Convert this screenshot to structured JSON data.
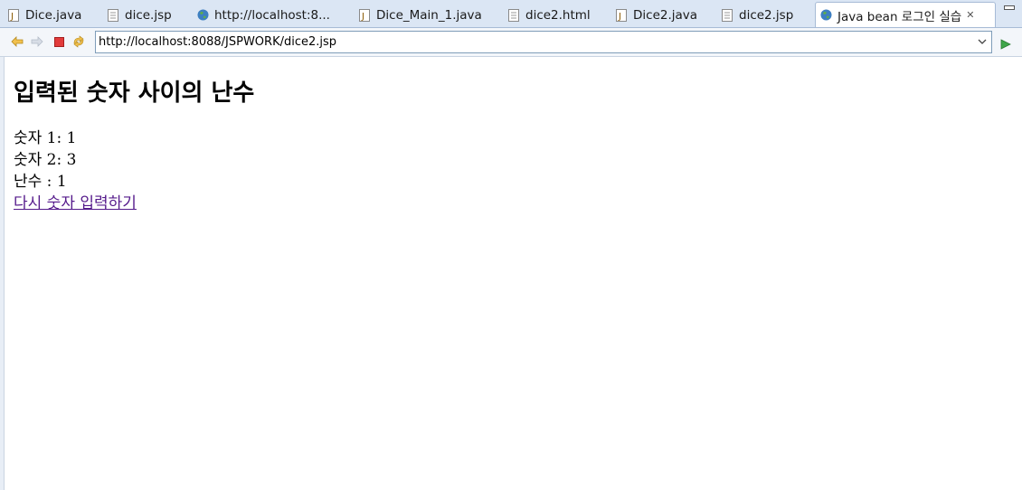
{
  "tabs": [
    {
      "label": "Dice.java",
      "icon": "java-file-icon"
    },
    {
      "label": "dice.jsp",
      "icon": "jsp-file-icon"
    },
    {
      "label": "http://localhost:8...",
      "icon": "globe-icon"
    },
    {
      "label": "Dice_Main_1.java",
      "icon": "java-file-icon"
    },
    {
      "label": "dice2.html",
      "icon": "html-file-icon"
    },
    {
      "label": "Dice2.java",
      "icon": "java-file-icon"
    },
    {
      "label": "dice2.jsp",
      "icon": "jsp-file-icon"
    },
    {
      "label": "Java bean 로그인 실습",
      "icon": "globe-icon",
      "active": true
    }
  ],
  "toolbar": {
    "url": "http://localhost:8088/JSPWORK/dice2.jsp"
  },
  "page": {
    "heading": "입력된 숫자 사이의 난수",
    "number1": "숫자 1: 1",
    "number2": "숫자 2: 3",
    "random": "난수 : 1",
    "retry_link": "다시 숫자 입력하기"
  },
  "colors": {
    "tabbar_bg": "#dbe6f4",
    "link_visited": "#551a8b"
  }
}
